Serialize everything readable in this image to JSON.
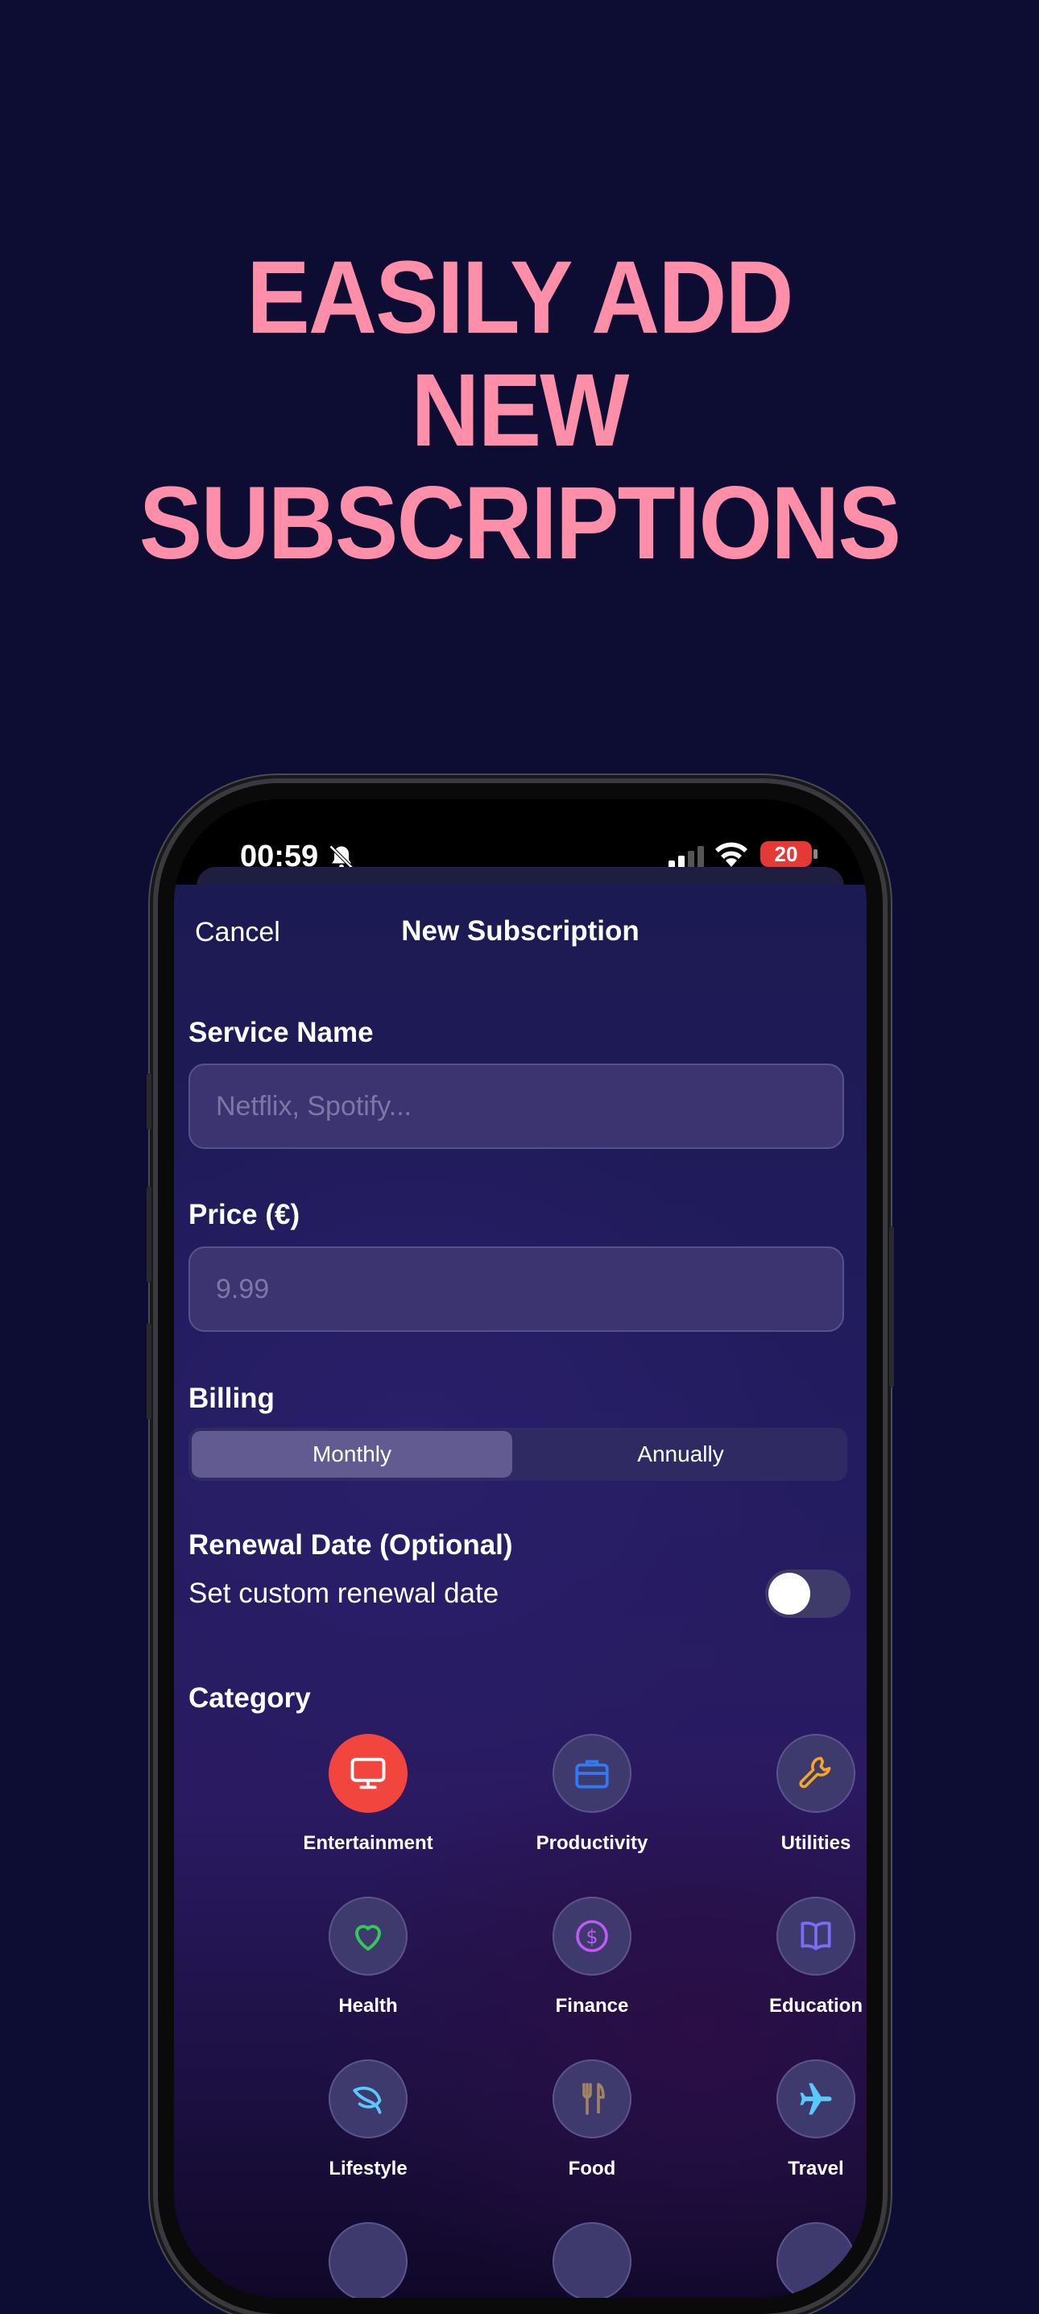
{
  "headline": [
    "EASILY ADD",
    "NEW",
    "SUBSCRIPTIONS"
  ],
  "status_bar": {
    "time": "00:59",
    "battery": "20"
  },
  "nav": {
    "cancel": "Cancel",
    "title": "New Subscription"
  },
  "form": {
    "service_name": {
      "label": "Service Name",
      "placeholder": "Netflix, Spotify..."
    },
    "price": {
      "label": "Price (€)",
      "placeholder": "9.99"
    },
    "billing": {
      "label": "Billing",
      "options": [
        "Monthly",
        "Annually"
      ],
      "selected": "Monthly"
    },
    "renewal": {
      "label": "Renewal Date (Optional)",
      "toggle_label": "Set custom renewal date",
      "toggle_on": false
    }
  },
  "category": {
    "label": "Category",
    "items": [
      {
        "name": "Entertainment",
        "icon": "tv-icon",
        "color": "#ffffff",
        "selected": true
      },
      {
        "name": "Productivity",
        "icon": "briefcase-icon",
        "color": "#2f7bf5"
      },
      {
        "name": "Utilities",
        "icon": "wrench-icon",
        "color": "#f5a623"
      },
      {
        "name": "Health",
        "icon": "heart-icon",
        "color": "#34c759"
      },
      {
        "name": "Finance",
        "icon": "dollar-circle-icon",
        "color": "#bf5af2"
      },
      {
        "name": "Education",
        "icon": "book-icon",
        "color": "#7a6cf5"
      },
      {
        "name": "Lifestyle",
        "icon": "leaf-icon",
        "color": "#5ac8fa"
      },
      {
        "name": "Food",
        "icon": "fork-knife-icon",
        "color": "#a2845e"
      },
      {
        "name": "Travel",
        "icon": "airplane-icon",
        "color": "#5ac8fa"
      }
    ]
  },
  "colors": {
    "background": "#0d0d33",
    "headline": "#ff8fa8",
    "selected_category": "#f2453d"
  }
}
